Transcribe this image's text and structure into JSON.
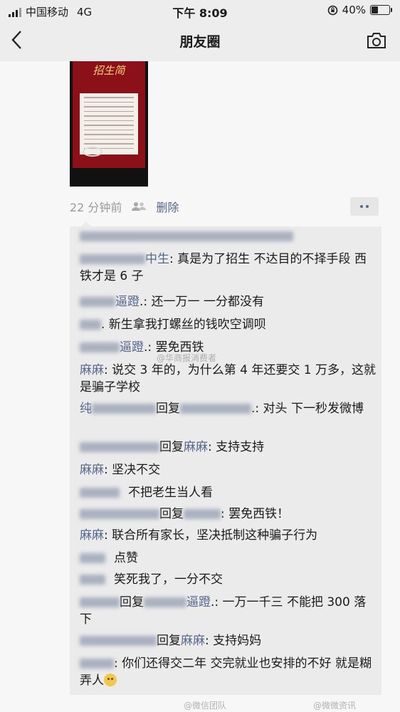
{
  "status_bar": {
    "carrier": "中国移动",
    "network": "4G",
    "time": "下午 8:09",
    "battery": "40%",
    "battery_level": 0.4
  },
  "nav": {
    "title": "朋友圈"
  },
  "poster": {
    "heading": "招生简"
  },
  "post_meta": {
    "time": "22 分钟前",
    "delete_label": "删除"
  },
  "comments": {
    "c1_name": "中生",
    "c1_text": ": 真是为了招生 不达目的不择手段 西铁才是 6 子",
    "c2_name": "逼蹬",
    "c2_text": ".: 还一万一 一分都没有",
    "c3_text": ". 新生拿我打螺丝的钱吹空调呗",
    "c4_name": "逼蹬",
    "c4_text": ".: 罢免西铁",
    "c5_name": "麻麻",
    "c5_text": ": 说交 3 年的，为什么第 4 年还要交 1 万多，这就是骗子学校",
    "c6_name": "纯",
    "c6_reply": "回复",
    "c6_text": ".: 对头 下一秒发微博",
    "c7_reply": "回复",
    "c7_target": "麻麻",
    "c7_text": ": 支持支持",
    "c8_name": "麻麻",
    "c8_text": ": 坚决不交",
    "c9_text": "不把老生当人看",
    "c10_reply": "回复",
    "c10_text": ": 罢免西铁！",
    "c11_name": "麻麻",
    "c11_text": ": 联合所有家长，坚决抵制这种骗子行为",
    "c12_text": "点赞",
    "c13_text": "笑死我了，一分不交",
    "c14_reply": "回复",
    "c14_target": "逼蹬",
    "c14_text": ".: 一万一千三 不能把 300 落下",
    "c15_reply": "回复",
    "c15_target": "麻麻",
    "c15_text": ": 支持妈妈",
    "c16_text": ": 你们还得交二年 交完就业也安排的不好 就是糊弄人"
  },
  "watermarks": {
    "w1": "@华商报消费者",
    "w2": "@微信团队",
    "w3": "@微微资讯"
  }
}
